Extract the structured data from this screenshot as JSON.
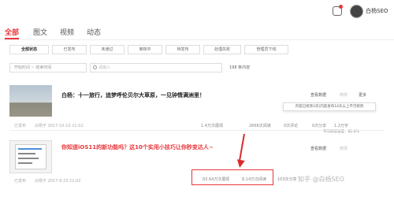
{
  "header": {
    "user_name": "白杨SEO"
  },
  "main_tabs": [
    {
      "label": "全部"
    },
    {
      "label": "图文"
    },
    {
      "label": "视频"
    },
    {
      "label": "动态"
    }
  ],
  "status_filters": [
    {
      "label": "全部状态"
    },
    {
      "label": "已发布"
    },
    {
      "label": "未通过"
    },
    {
      "label": "审核中"
    },
    {
      "label": "待发布"
    },
    {
      "label": "处理失败"
    },
    {
      "label": "管理员下线"
    }
  ],
  "filters": {
    "date_range": "开始时间 ~ 结束时间",
    "search_placeholder": "请输入",
    "total": "198 条内容"
  },
  "articles": [
    {
      "title": "白杨：十一旅行，追梦呼伦贝尔大草原，一见钟情满洲里！",
      "status": "已发布",
      "time": "白杨于 2017-10-10 21:02",
      "stats": [
        "1.4万次展现",
        "2666次阅读",
        "0次评论",
        "0次分享",
        "1.2万字"
      ],
      "actions": {
        "view_data": "查看数据",
        "edit": "修改",
        "more": "更多"
      },
      "tooltip": "内容已修改3次(内容发布14天以上不可修改",
      "read_rate": "平均阅读进度：82.8%"
    },
    {
      "title": "你知道iOS11的新功能吗？这10个实用小技巧让你秒变达人~",
      "status": "已发布",
      "time": "白杨于 2017-9-23 21:02",
      "stats": [
        "83.64万次展现",
        "8.14万次阅读",
        "103次分享"
      ],
      "actions": {
        "view_data": "查看数据",
        "edit": "修改"
      }
    }
  ],
  "watermark": "知乎 @白杨SEO"
}
